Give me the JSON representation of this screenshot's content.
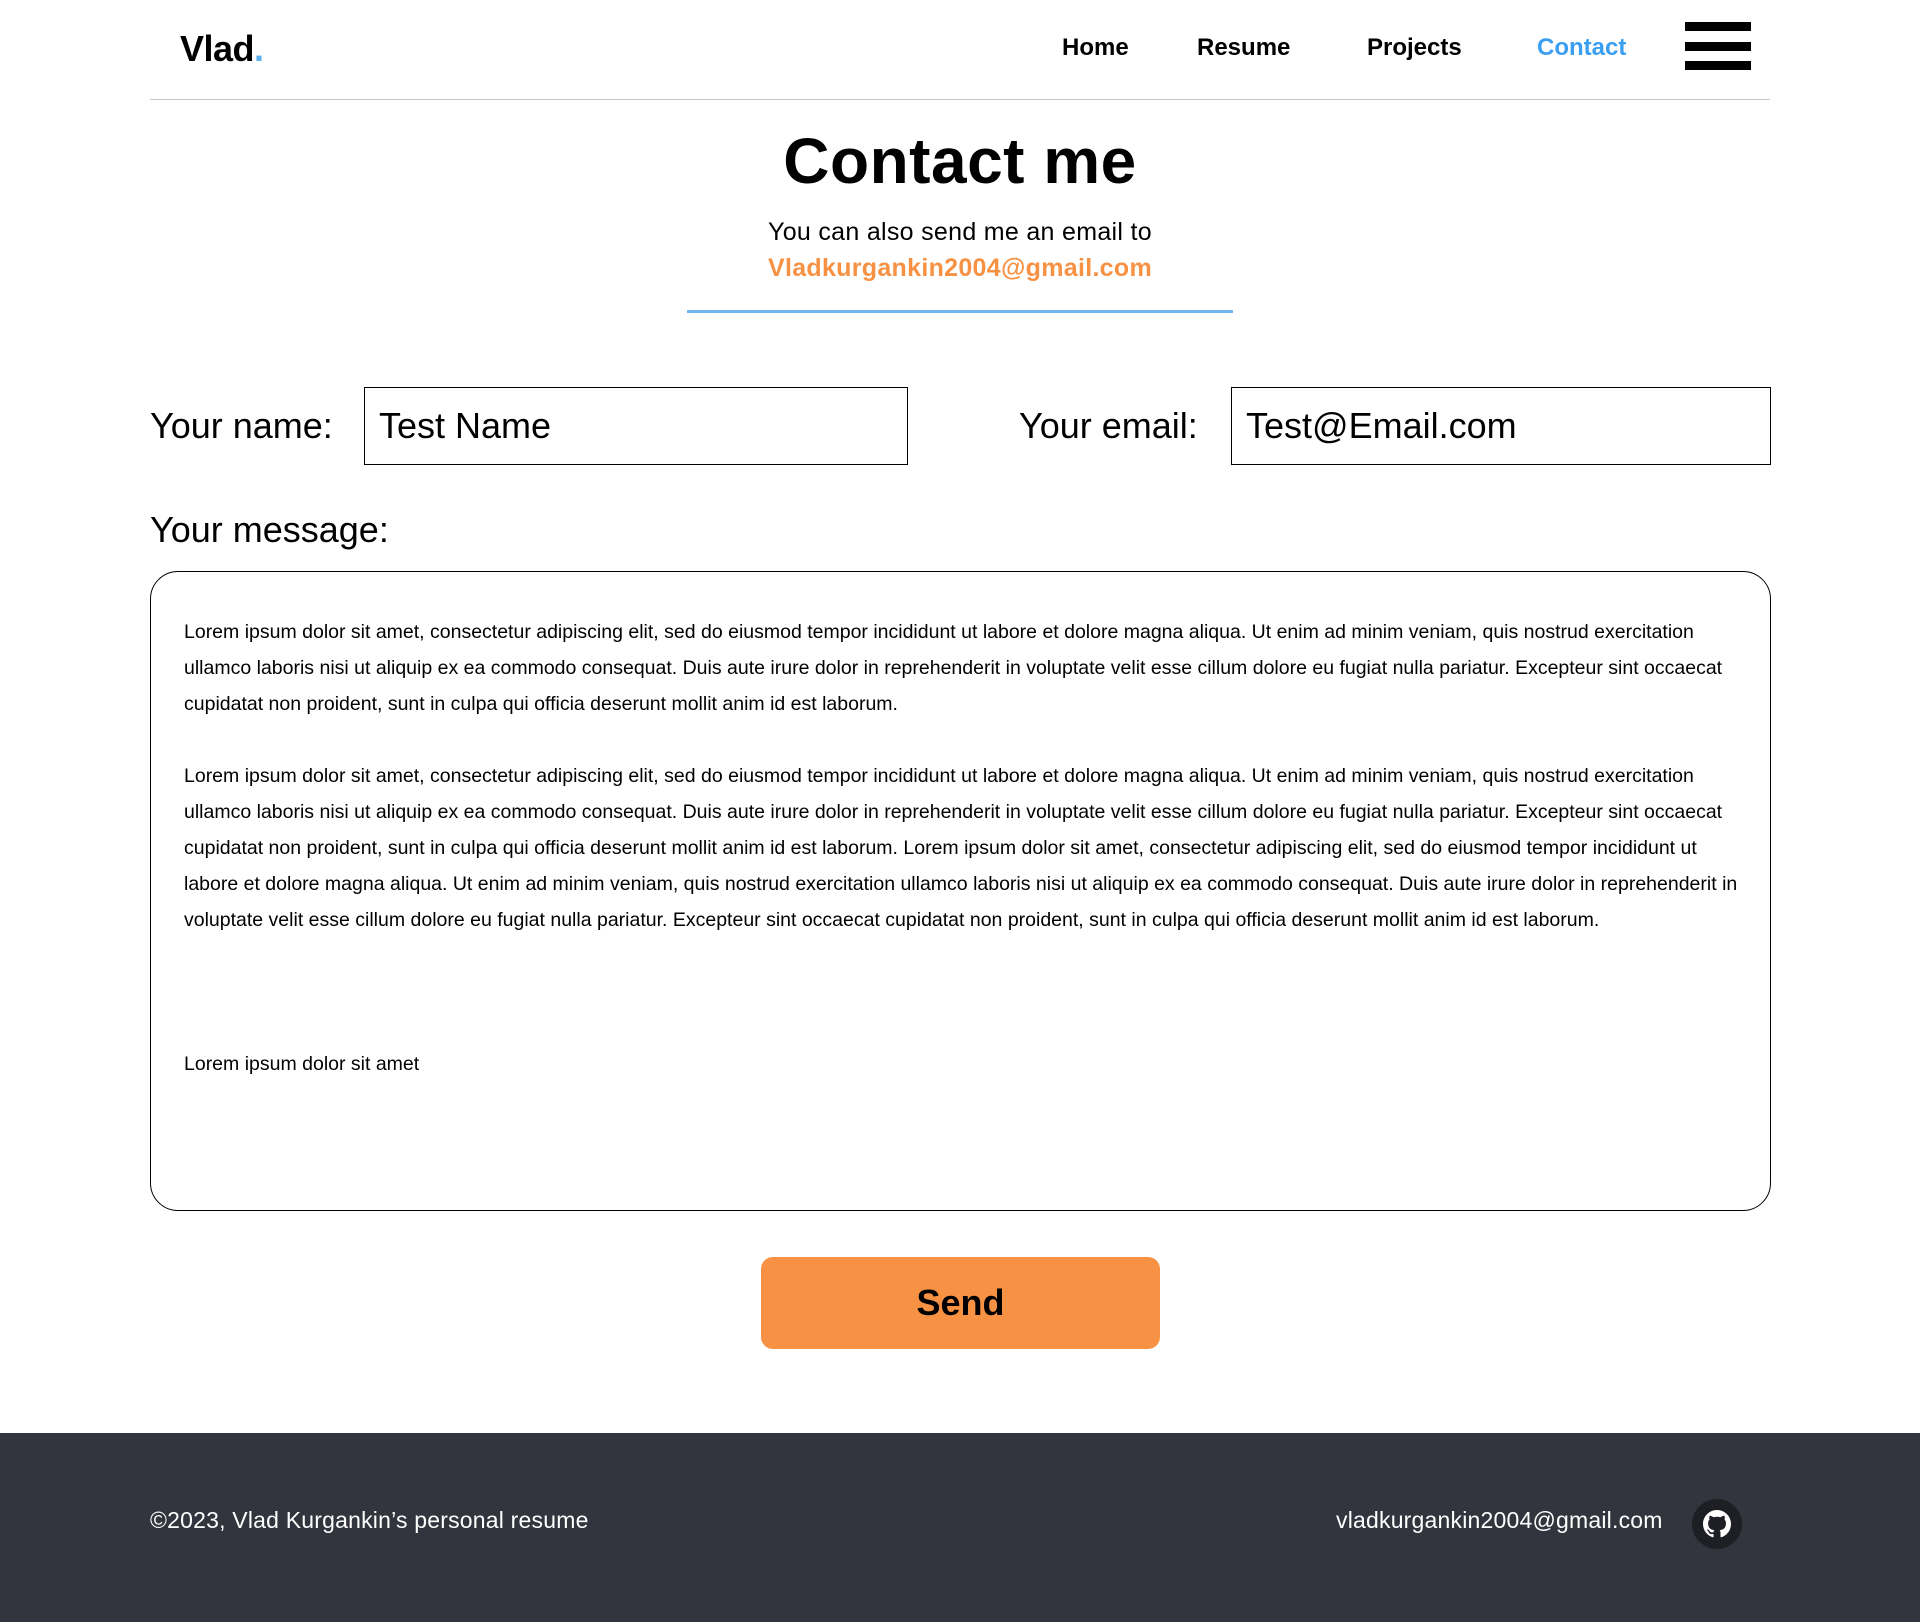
{
  "header": {
    "logo_text": "Vlad",
    "logo_dot": ".",
    "nav": {
      "home": "Home",
      "resume": "Resume",
      "projects": "Projects",
      "contact": "Contact"
    },
    "menu_icon": "hamburger-menu-icon"
  },
  "hero": {
    "title": "Contact me",
    "subtitle": "You can also send me an email to",
    "email": "Vladkurgankin2004@gmail.com"
  },
  "form": {
    "name_label": "Your name:",
    "name_value": "Test Name",
    "email_label": "Your email:",
    "email_value": "Test@Email.com",
    "message_label": "Your message:",
    "message_paragraphs": [
      "Lorem ipsum dolor sit amet, consectetur adipiscing elit, sed do eiusmod tempor incididunt ut labore et dolore magna aliqua. Ut enim ad minim veniam, quis nostrud exercitation ullamco laboris nisi ut aliquip ex ea commodo consequat. Duis aute irure dolor in reprehenderit in voluptate velit esse cillum dolore eu fugiat nulla pariatur. Excepteur sint occaecat cupidatat non proident, sunt in culpa qui officia deserunt mollit anim id est laborum.",
      "Lorem ipsum dolor sit amet, consectetur adipiscing elit, sed do eiusmod tempor incididunt ut labore et dolore magna aliqua. Ut enim ad minim veniam, quis nostrud exercitation ullamco laboris nisi ut aliquip ex ea commodo consequat. Duis aute irure dolor in reprehenderit in voluptate velit esse cillum dolore eu fugiat nulla pariatur. Excepteur sint occaecat cupidatat non proident, sunt in culpa qui officia deserunt mollit anim id est laborum. Lorem ipsum dolor sit amet, consectetur adipiscing elit, sed do eiusmod tempor incididunt ut labore et dolore magna aliqua. Ut enim ad minim veniam, quis nostrud exercitation ullamco laboris nisi ut aliquip ex ea commodo consequat. Duis aute irure dolor in reprehenderit in voluptate velit esse cillum dolore eu fugiat nulla pariatur. Excepteur sint occaecat cupidatat non proident, sunt in culpa qui officia deserunt mollit anim id est laborum.",
      "Lorem ipsum dolor sit amet"
    ],
    "send_label": "Send"
  },
  "footer": {
    "copyright": "©2023, Vlad Kurgankin’s personal resume",
    "email": "vladkurgankin2004@gmail.com",
    "github_icon": "github-icon"
  },
  "colors": {
    "accent_orange": "#f79143",
    "active_nav_blue": "#3a9ff2",
    "rule_blue": "#6fb4ee",
    "logo_dot_blue": "#5ab0f0",
    "footer_bg": "#32343e"
  }
}
